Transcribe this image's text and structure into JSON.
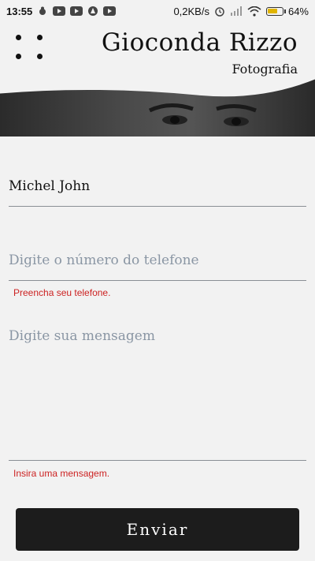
{
  "status_bar": {
    "time": "13:55",
    "speed": "0,2KB/s",
    "battery": "64%"
  },
  "header": {
    "title": "Gioconda Rizzo",
    "subtitle": "Fotografia"
  },
  "form": {
    "name": {
      "value": "Michel John"
    },
    "phone": {
      "placeholder": "Digite o número do telefone",
      "error": "Preencha seu telefone."
    },
    "message": {
      "placeholder": "Digite sua mensagem",
      "error": "Insira uma mensagem."
    },
    "submit_label": "Enviar"
  },
  "colors": {
    "background": "#f2f2f2",
    "button": "#1c1c1c",
    "error": "#cc2222",
    "placeholder": "#8a96a4"
  }
}
